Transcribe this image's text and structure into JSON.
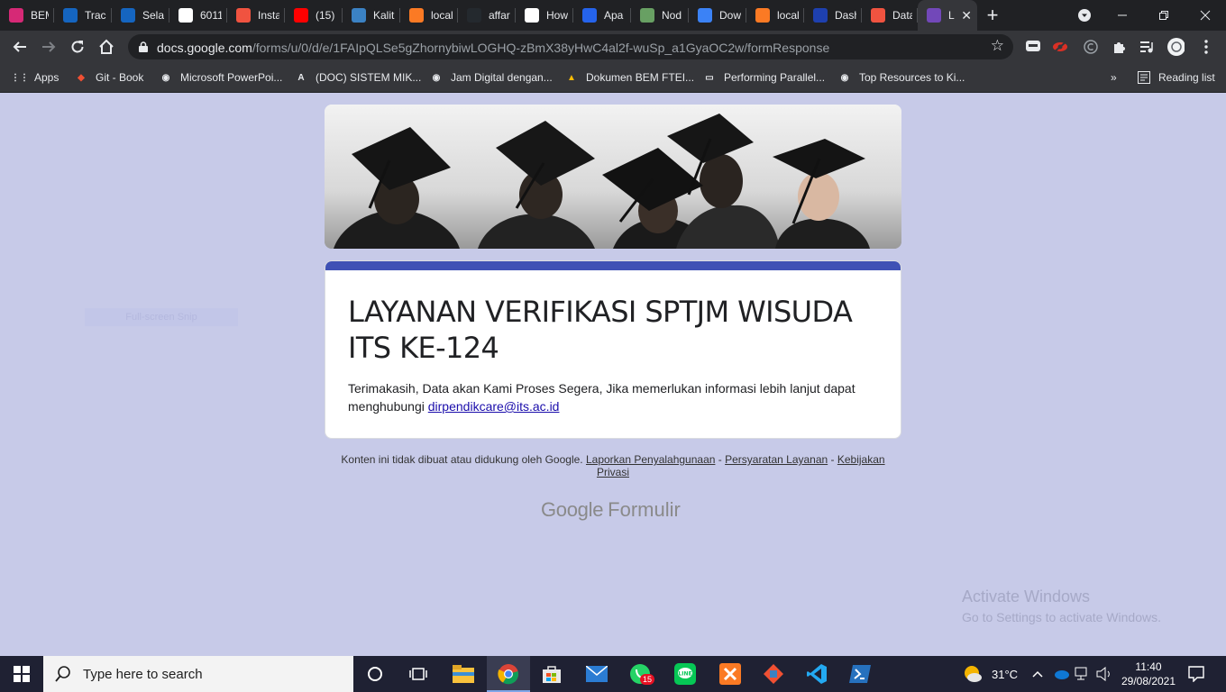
{
  "browser": {
    "tabs": [
      {
        "title": "BEM",
        "icon": "instagram-icon",
        "color": "#d62976"
      },
      {
        "title": "Track",
        "icon": "its-icon",
        "color": "#1565c0"
      },
      {
        "title": "Selan",
        "icon": "its-icon",
        "color": "#1565c0"
      },
      {
        "title": "6011",
        "icon": "google-icon",
        "color": "#ffffff"
      },
      {
        "title": "Insta",
        "icon": "laravel-icon",
        "color": "#f05340"
      },
      {
        "title": "(15)",
        "icon": "youtube-icon",
        "color": "#ff0000"
      },
      {
        "title": "Kalit",
        "icon": "kalita-icon",
        "color": "#3b82c4"
      },
      {
        "title": "local",
        "icon": "xampp-icon",
        "color": "#fb7a24"
      },
      {
        "title": "affar",
        "icon": "github-icon",
        "color": "#24292e"
      },
      {
        "title": "How",
        "icon": "globe-icon",
        "color": "#ffffff"
      },
      {
        "title": "Apa",
        "icon": "medium-icon",
        "color": "#2563eb"
      },
      {
        "title": "Nod",
        "icon": "nodejs-icon",
        "color": "#68a063"
      },
      {
        "title": "Dow",
        "icon": "download-icon",
        "color": "#3b82f6"
      },
      {
        "title": "local",
        "icon": "xampp-icon",
        "color": "#fb7a24"
      },
      {
        "title": "Dash",
        "icon": "dash-icon",
        "color": "#1e40af"
      },
      {
        "title": "Data",
        "icon": "laravel-icon",
        "color": "#f05340"
      },
      {
        "title": "L",
        "icon": "google-forms-icon",
        "color": "#7248b9",
        "active": true
      }
    ],
    "url_host": "docs.google.com",
    "url_path": "/forms/u/0/d/e/1FAIpQLSe5gZhornybiwLOGHQ-zBmX38yHwC4al2f-wuSp_a1GyaOC2w/formResponse",
    "bookmarks": [
      {
        "label": "Apps",
        "icon": "apps-grid-icon"
      },
      {
        "label": "Git - Book",
        "icon": "git-icon"
      },
      {
        "label": "Microsoft PowerPoi...",
        "icon": "globe-icon"
      },
      {
        "label": "(DOC) SISTEM MIK...",
        "icon": "academia-icon"
      },
      {
        "label": "Jam Digital dengan...",
        "icon": "globe-icon"
      },
      {
        "label": "Dokumen BEM FTEI...",
        "icon": "google-drive-icon"
      },
      {
        "label": "Performing Parallel...",
        "icon": "monitor-icon"
      },
      {
        "label": "Top Resources to Ki...",
        "icon": "globe-icon"
      }
    ],
    "bookmarks_more": "»",
    "reading_list": "Reading list"
  },
  "form": {
    "title": "LAYANAN VERIFIKASI SPTJM WISUDA ITS KE-124",
    "message": "Terimakasih, Data akan Kami Proses Segera, Jika memerlukan informasi lebih lanjut dapat menghubungi",
    "email": "dirpendikcare@its.ac.id",
    "accent_color": "#3f51b5",
    "background_color": "#c7cae8"
  },
  "footer": {
    "disclaimer": "Konten ini tidak dibuat atau didukung oleh Google.",
    "report_link": "Laporkan Penyalahgunaan",
    "terms_link": "Persyaratan Layanan",
    "privacy_link": "Kebijakan Privasi",
    "logo_google": "Google",
    "logo_product": "Formulir"
  },
  "overlay": {
    "snip_label": "Full-screen Snip",
    "activate_title": "Activate Windows",
    "activate_sub": "Go to Settings to activate Windows."
  },
  "taskbar": {
    "search_placeholder": "Type here to search",
    "weather_temp": "31°C",
    "time": "11:40",
    "date": "29/08/2021",
    "whatsapp_badge": "15"
  }
}
